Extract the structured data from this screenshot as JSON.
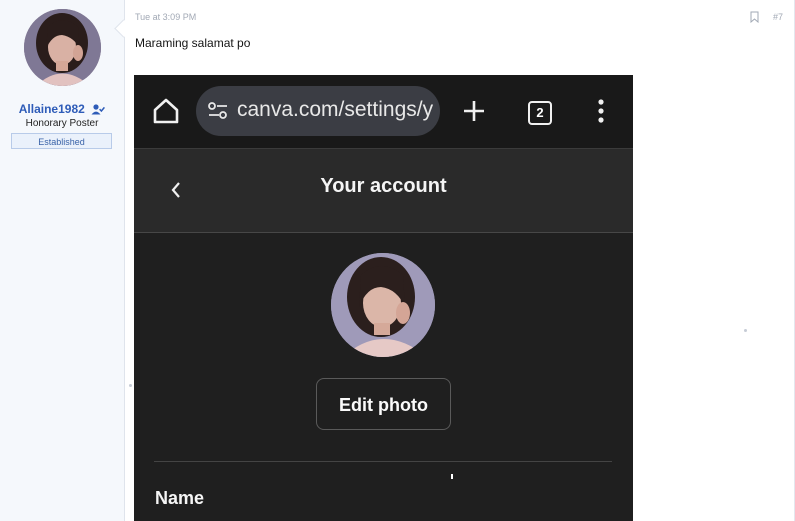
{
  "post": {
    "author": {
      "username": "Allaine1982",
      "title": "Honorary Poster",
      "banner": "Established",
      "avatar_icon": "user-avatar-photo",
      "verified_icon": "user-check-icon"
    },
    "time": "Tue at 3:09 PM",
    "number": "#7",
    "bookmark_icon": "bookmark-icon",
    "message": "Maraming salamat po"
  },
  "screenshot": {
    "browser": {
      "url": "canva.com/settings/y",
      "tab_count": "2",
      "home_icon": "home-icon",
      "site_settings_icon": "site-settings-icon",
      "new_tab_icon": "plus-icon",
      "menu_icon": "more-vertical-icon"
    },
    "page": {
      "back_icon": "chevron-left-icon",
      "title": "Your account",
      "edit_photo_label": "Edit photo",
      "name_label": "Name"
    }
  },
  "colors": {
    "link_blue": "#2e5cb8",
    "sidebar_bg": "#f5f8fc",
    "dark_bg": "#1f1f1f"
  }
}
